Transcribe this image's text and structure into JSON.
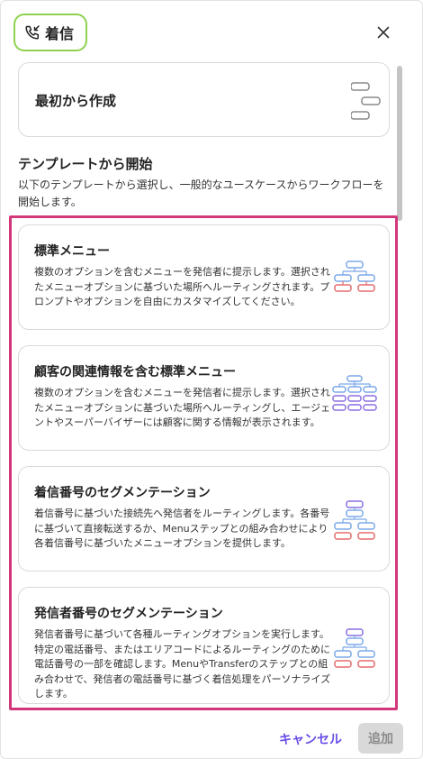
{
  "header": {
    "chip_label": "着信",
    "chip_icon": "phone-incoming-icon",
    "close_icon": "close-icon"
  },
  "start": {
    "label": "最初から作成",
    "icon": "flow-blocks-icon"
  },
  "templates_section": {
    "title": "テンプレートから開始",
    "description": "以下のテンプレートから選択し、一般的なユースケースからワークフローを開始します。"
  },
  "templates": [
    {
      "title": "標準メニュー",
      "description": "複数のオプションを含むメニューを発信者に提示します。選択されたメニューオプションに基づいた場所へルーティングされます。プロンプトやオプションを自由にカスタマイズしてください。",
      "icon": "menu-flow-icon"
    },
    {
      "title": "顧客の関連情報を含む標準メニュー",
      "description": "複数のオプションを含むメニューを発信者に提示します。選択されたメニューオプションに基づいた場所へルーティングし、エージェントやスーパーバイザーには顧客に関する情報が表示されます。",
      "icon": "menu-customer-info-flow-icon"
    },
    {
      "title": "着信番号のセグメンテーション",
      "description": "着信番号に基づいた接続先へ発信者をルーティングします。各番号に基づいて直接転送するか、Menuステップとの組み合わせにより各着信番号に基づいたメニューオプションを提供します。",
      "icon": "dialed-number-flow-icon"
    },
    {
      "title": "発信者番号のセグメンテーション",
      "description": "発信者番号に基づいて各種ルーティングオプションを実行します。特定の電話番号、またはエリアコードによるルーティングのために電話番号の一部を確認します。MenuやTransferのステップとの組み合わせで、発信者の電話番号に基づく着信処理をパーソナライズします。",
      "icon": "caller-id-flow-icon"
    }
  ],
  "footer": {
    "cancel_label": "キャンセル",
    "add_label": "追加"
  },
  "colors": {
    "chip_border": "#8fd14f",
    "highlight_border": "#d2377a",
    "accent": "#6a4ee8",
    "node_blue": "#7aa8e8",
    "node_red": "#e56b6b",
    "node_purple": "#8b6fe0"
  }
}
